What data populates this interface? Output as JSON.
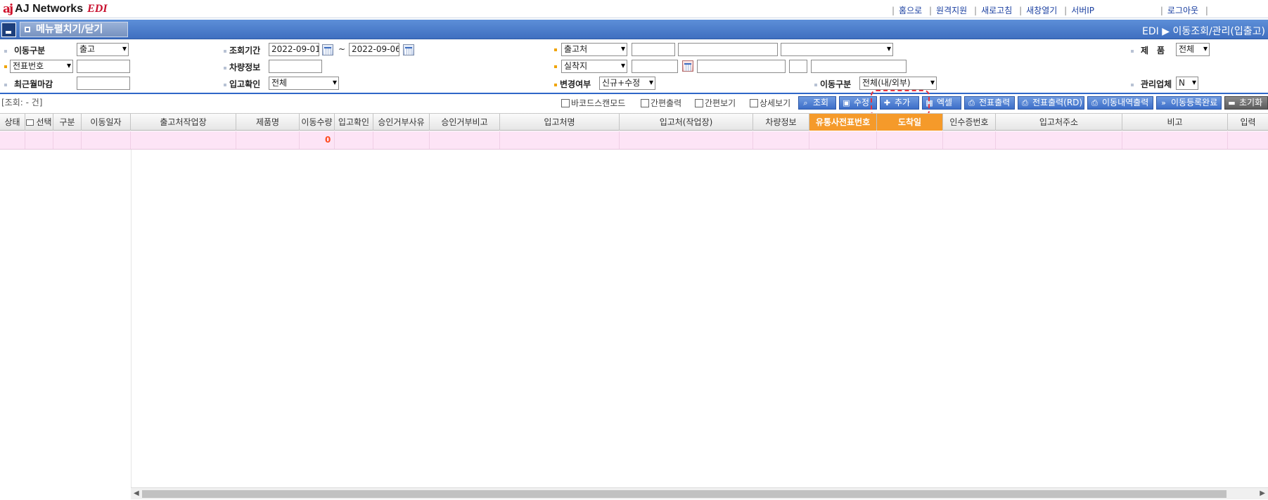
{
  "app": {
    "logo_mark": "aj",
    "logo_text": "AJ Networks",
    "logo_edi": "EDI"
  },
  "toplinks": [
    "홈으로",
    "원격지원",
    "새로고침",
    "새창열기",
    "서버IP",
    "로그아웃"
  ],
  "header": {
    "menu_toggle": "메뉴펼치기/닫기",
    "breadcrumb": "EDI ▶ 이동조회/관리(입출고)"
  },
  "filters": {
    "move_type_label": "이동구분",
    "move_type_value": "출고",
    "period_label": "조회기간",
    "date_from": "2022-09-01",
    "date_to": "2022-09-06",
    "tilde": "~",
    "shipper_label": "출고처",
    "product_label": "제　품",
    "product_value": "전체",
    "slip_no_value": "전표번호",
    "vehicle_label": "차량정보",
    "receiver_label": "실착지",
    "closing_label": "최근월마감",
    "in_confirm_label": "입고확인",
    "in_confirm_value": "전체",
    "change_label": "변경여부",
    "change_value": "신규+수정",
    "move_type2_label": "이동구분",
    "move_type2_value": "전체(내/외부)",
    "mgmt_label": "관리업체",
    "mgmt_value": "N"
  },
  "toolbar": {
    "count": "[조회: - 건]",
    "checks": [
      "바코드스캔모드",
      "간편출력",
      "간편보기",
      "상세보기"
    ],
    "buttons": [
      "조회",
      "수정",
      "추가",
      "엑셀",
      "전표출력",
      "전표출력(RD)",
      "이동내역출력",
      "이동등록완료",
      "초기화"
    ]
  },
  "grid": {
    "columns": [
      "상태",
      "선택",
      "구분",
      "이동일자",
      "출고처작업장",
      "제품명",
      "이동수량",
      "입고확인",
      "승인거부사유",
      "승인거부비고",
      "입고처명",
      "입고처(작업장)",
      "차량정보",
      "유통사전표번호",
      "도착일",
      "인수증번호",
      "입고처주소",
      "비고",
      "입력"
    ],
    "total_qty": "0"
  },
  "colors": {
    "accent": "#3f6fc0",
    "highlight_column": "#f59a2a",
    "row_bg": "#fde4f6",
    "quantity": "#ff4b1e",
    "annotation": "#e8343f"
  }
}
